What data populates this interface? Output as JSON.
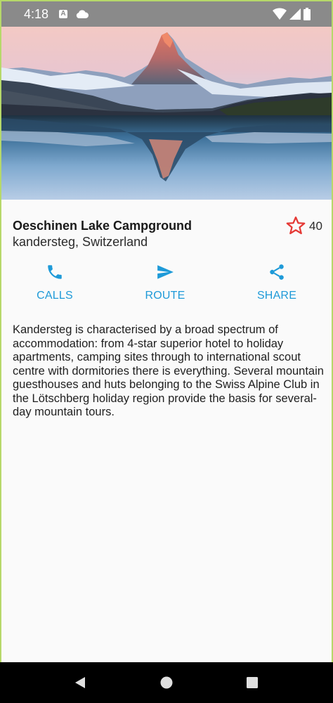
{
  "status_bar": {
    "time": "4:18",
    "icons": [
      "a-notification-icon",
      "cloud-icon",
      "wifi-icon",
      "signal-icon",
      "battery-icon"
    ]
  },
  "hero": {
    "image": "matterhorn-lake-reflection"
  },
  "place": {
    "name": "Oeschinen Lake Campground",
    "location": "kandersteg, Switzerland",
    "favorite_count": "40",
    "favorite_icon": "star-outline-icon",
    "favorite_color": "#e53935"
  },
  "actions": [
    {
      "label": "CALLS",
      "icon": "phone-icon"
    },
    {
      "label": "ROUTE",
      "icon": "send-icon"
    },
    {
      "label": "SHARE",
      "icon": "share-icon"
    }
  ],
  "accent_color": "#1e9ad8",
  "description": "Kandersteg is characterised by a broad spectrum of accommodation: from 4-star superior hotel to holiday apartments, camping sites through to international scout centre with dormitories there is everything. Several mountain guesthouses and huts belonging to the Swiss Alpine Club in the Lötschberg holiday region provide the basis for several-day mountain tours.",
  "nav_bar": {
    "icons": [
      "back-icon",
      "home-icon",
      "recents-icon"
    ]
  }
}
